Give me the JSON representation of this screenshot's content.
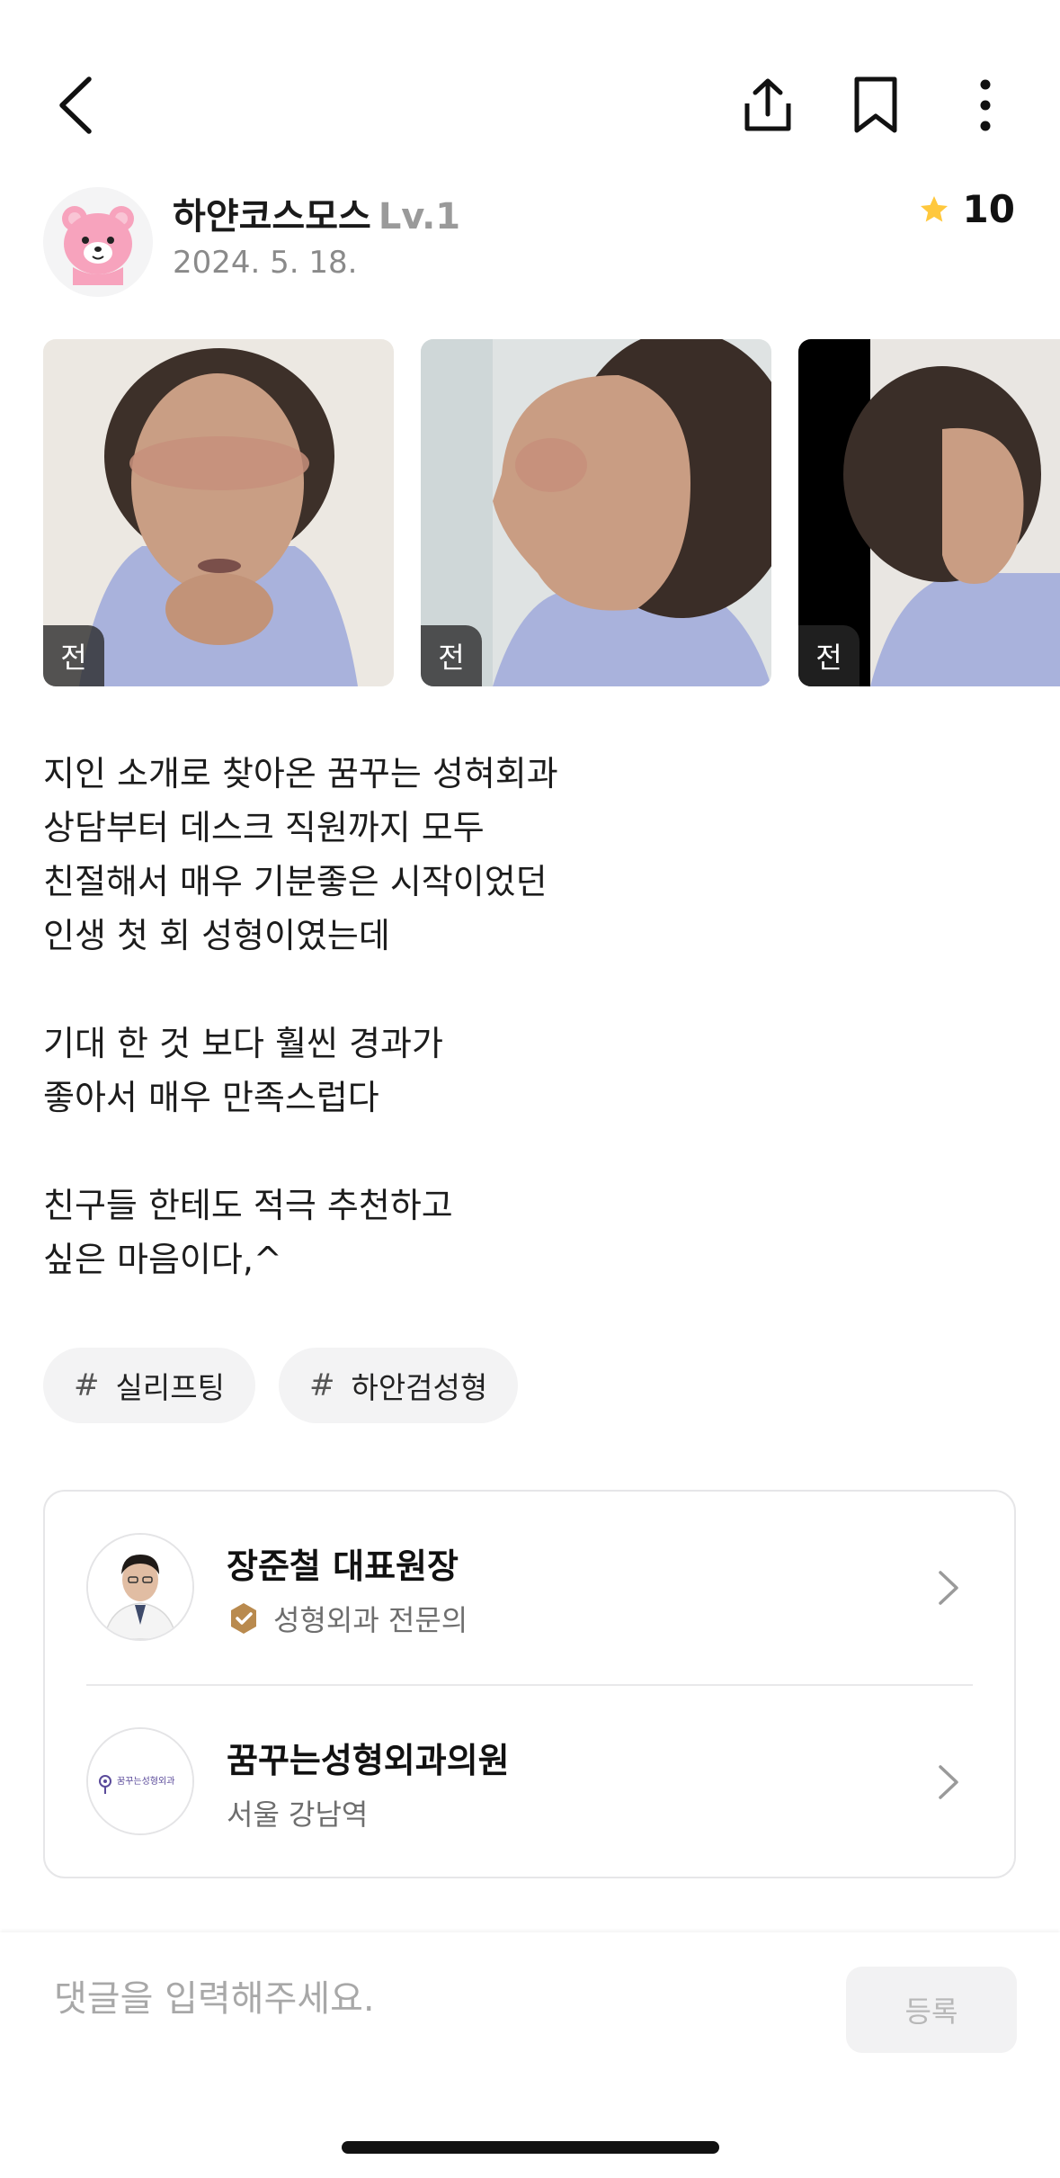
{
  "header": {
    "back_icon": "chevron-left-icon",
    "share_icon": "share-icon",
    "bookmark_icon": "bookmark-icon",
    "more_icon": "more-vertical-icon"
  },
  "author": {
    "name": "하얀코스모스",
    "level": "Lv.1",
    "date": "2024. 5. 18.",
    "avatar_icon": "bear-avatar-icon"
  },
  "rating": {
    "icon": "star-icon",
    "value": "10",
    "star_color": "#FFC83D"
  },
  "photos": [
    {
      "badge": "전"
    },
    {
      "badge": "전"
    },
    {
      "badge": "전"
    }
  ],
  "body": {
    "para1": [
      "지인 소개로 찾아온 꿈꾸는 성혀회과",
      "상담부터 데스크 직원까지 모두",
      "친절해서 매우 기분좋은 시작이었던",
      "인생 첫 회 성형이였는데"
    ],
    "para2": [
      "기대 한 것 보다 훨씬 경과가",
      "좋아서 매우 만족스럽다"
    ],
    "para3": [
      "친구들 한테도 적극 추천하고",
      "싶은 마음이다,^"
    ]
  },
  "tags": [
    {
      "hash": "#",
      "label": "실리프팅"
    },
    {
      "hash": "#",
      "label": "하안검성형"
    }
  ],
  "doctor": {
    "name": "장준철 대표원장",
    "badge_icon": "verified-badge-icon",
    "specialty": "성형외과 전문의"
  },
  "clinic": {
    "logo_text": "꿈꾸는성형외과",
    "name": "꿈꾸는성형외과의원",
    "location": "서울 강남역"
  },
  "comment": {
    "placeholder": "댓글을 입력해주세요.",
    "submit_label": "등록"
  },
  "colors": {
    "badge_gold": "#B98A4E",
    "star": "#FFC83D"
  }
}
